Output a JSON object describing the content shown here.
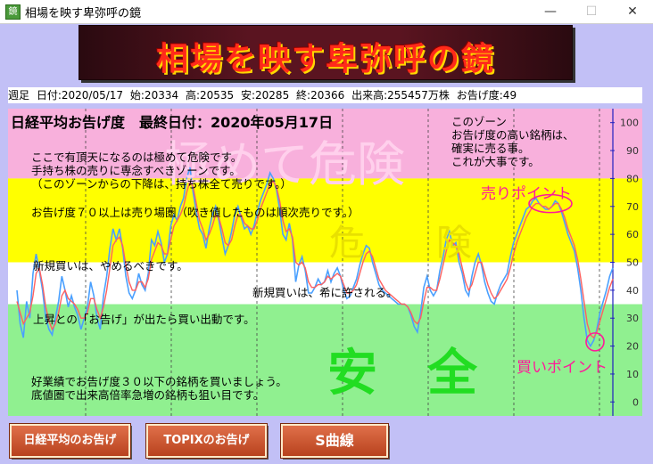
{
  "window": {
    "title": "相場を映す卑弥呼の鏡",
    "app_icon_glyph": "鏡",
    "minimize": "—",
    "maximize": "☐",
    "close": "✕"
  },
  "banner": {
    "text": "相場を映す卑弥呼の鏡"
  },
  "info": {
    "frequency": "週足",
    "date": "日付:2020/05/17",
    "open": "始:20334",
    "high": "高:20535",
    "low": "安:20285",
    "close": "終:20366",
    "volume": "出来高:255457万株",
    "oracle": "お告げ度:49"
  },
  "chart_labels": {
    "title": "日経平均お告げ度　最終日付：2020年05月17日",
    "danger_watermark": "極めて危険",
    "danger_watermark2": "危　　険",
    "safe_watermark": "安　全",
    "top_note": [
      "このゾーン",
      "お告げ度の高い銘柄は、",
      "確実に売る事。",
      "これが大事です。"
    ],
    "danger_notes": [
      "ここで有頂天になるのは極めて危険です。",
      "手持ち株の売りに専念すべきゾーンです。",
      "（このゾーンからの下降は、持ち株全て売りです。）"
    ],
    "sell_zone_note": "お告げ度７０以上は売り場圏（吹き値したものは順次売りです。）",
    "no_buy_note": "新規買いは、やめるべきです。",
    "rare_buy_note": "新規買いは、希に許される。",
    "rise_note": "上昇との「お告げ」が出たら買い出動です。",
    "good_perf_notes": [
      "好業績でお告げ度３０以下の銘柄を買いましょう。",
      "底値圏で出来高倍率急増の銘柄も狙い目です。"
    ],
    "sell_point": "売りポイント",
    "buy_point": "買いポイント"
  },
  "chart_data": {
    "type": "line",
    "ylim": [
      -5,
      105
    ],
    "yticks": [
      "100",
      "90",
      "80",
      "70",
      "60",
      "50",
      "40",
      "30",
      "20",
      "10",
      "0"
    ],
    "zones": [
      {
        "from": 80,
        "to": 105,
        "color": "#f8b0dc"
      },
      {
        "from": 50,
        "to": 80,
        "color": "#ffff00"
      },
      {
        "from": 35,
        "to": 50,
        "color": "#ffffff"
      },
      {
        "from": -5,
        "to": 35,
        "color": "#90f090"
      }
    ],
    "series": [
      {
        "color": "#4aa0ff",
        "values": [
          40,
          28,
          23,
          36,
          30,
          46,
          53,
          47,
          40,
          30,
          26,
          24,
          30,
          36,
          45,
          40,
          34,
          38,
          34,
          31,
          26,
          30,
          34,
          43,
          38,
          30,
          26,
          38,
          45,
          55,
          62,
          58,
          62,
          55,
          45,
          39,
          37,
          40,
          46,
          42,
          40,
          46,
          58,
          56,
          61,
          57,
          50,
          53,
          63,
          67,
          65,
          70,
          73,
          80,
          84,
          75,
          68,
          62,
          60,
          55,
          62,
          67,
          70,
          65,
          59,
          53,
          56,
          61,
          67,
          70,
          66,
          62,
          63,
          60,
          63,
          68,
          72,
          75,
          78,
          82,
          80,
          76,
          69,
          60,
          58,
          64,
          58,
          43,
          49,
          52,
          47,
          39,
          39,
          41,
          44,
          42,
          43,
          47,
          43,
          46,
          48,
          45,
          40,
          37,
          38,
          41,
          44,
          49,
          53,
          56,
          55,
          50,
          46,
          42,
          40,
          39,
          38,
          37,
          36,
          35,
          35,
          35,
          34,
          31,
          27,
          25,
          32,
          41,
          45,
          40,
          38,
          40,
          47,
          52,
          58,
          61,
          56,
          57,
          50,
          46,
          40,
          38,
          45,
          50,
          53,
          49,
          43,
          39,
          36,
          35,
          39,
          42,
          44,
          46,
          52,
          57,
          60,
          63,
          66,
          69,
          70,
          72,
          73,
          71,
          70,
          69,
          69,
          70,
          72,
          71,
          68,
          64,
          60,
          57,
          54,
          48,
          40,
          30,
          22,
          20,
          22,
          26,
          32,
          36,
          40,
          45,
          48
        ]
      },
      {
        "color": "#ff6060",
        "values": [
          36,
          32,
          28,
          30,
          32,
          38,
          46,
          48,
          42,
          34,
          29,
          26,
          28,
          32,
          38,
          40,
          37,
          36,
          35,
          33,
          30,
          30,
          32,
          37,
          37,
          33,
          30,
          34,
          40,
          48,
          56,
          58,
          59,
          56,
          49,
          43,
          40,
          40,
          43,
          43,
          41,
          44,
          51,
          54,
          57,
          56,
          53,
          53,
          58,
          63,
          65,
          67,
          70,
          75,
          79,
          77,
          71,
          65,
          62,
          58,
          60,
          63,
          67,
          66,
          62,
          57,
          56,
          58,
          63,
          67,
          67,
          64,
          63,
          62,
          62,
          65,
          69,
          72,
          75,
          78,
          79,
          77,
          72,
          65,
          61,
          62,
          59,
          50,
          49,
          50,
          48,
          43,
          41,
          41,
          42,
          42,
          43,
          45,
          44,
          45,
          46,
          45,
          42,
          39,
          39,
          40,
          42,
          46,
          50,
          53,
          54,
          52,
          48,
          44,
          42,
          40,
          39,
          38,
          37,
          36,
          35,
          35,
          34,
          32,
          29,
          28,
          30,
          36,
          41,
          41,
          40,
          40,
          44,
          49,
          54,
          58,
          57,
          56,
          53,
          48,
          43,
          40,
          42,
          46,
          50,
          50,
          46,
          42,
          39,
          37,
          38,
          40,
          42,
          44,
          48,
          53,
          57,
          60,
          63,
          66,
          68,
          70,
          71,
          71,
          70,
          70,
          69,
          70,
          71,
          71,
          69,
          66,
          62,
          59,
          56,
          51,
          44,
          36,
          28,
          24,
          23,
          25,
          29,
          33,
          37,
          41,
          44
        ]
      }
    ]
  }
}
